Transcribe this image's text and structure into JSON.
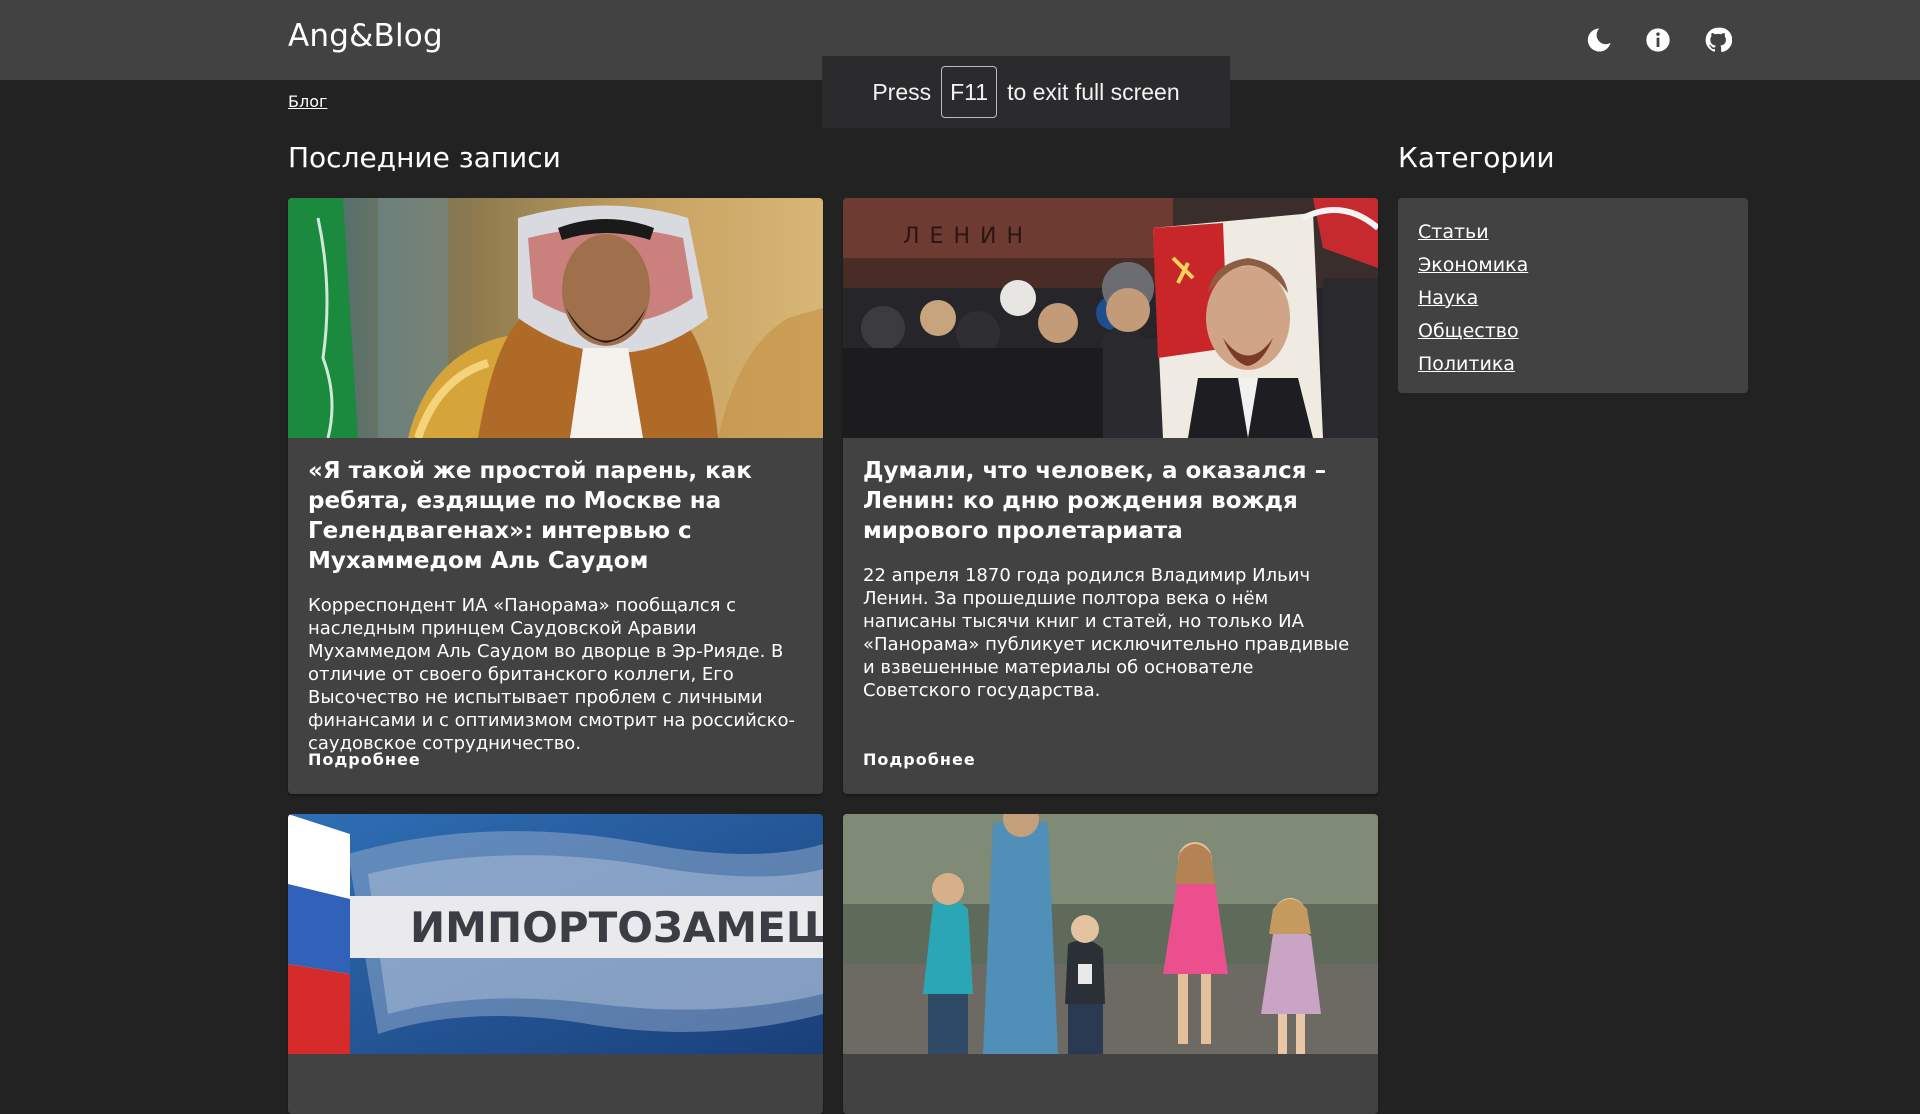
{
  "header": {
    "brand": "Ang&Blog",
    "icons": [
      "theme-toggle-icon",
      "info-icon",
      "github-icon"
    ]
  },
  "fullscreen_notice": {
    "prefix": "Press",
    "key": "F11",
    "suffix": "to exit full screen"
  },
  "breadcrumb": "Блог",
  "main": {
    "heading": "Последние записи",
    "more_label": "Подробнее",
    "posts": [
      {
        "title": "«Я такой же простой парень, как ребята, ездящие по Москве на Гелендвагенах»: интервью с Мухаммедом Аль Саудом",
        "excerpt": "Корреспондент ИА «Панорама» пообщался с наследным принцем Саудовской Аравии Мухаммедом Аль Саудом во дворце в Эр-Рияде. В отличие от своего британского коллеги, Его Высочество не испытывает проблем с личными финансами и с оптимизмом смотрит на российско-саудовское сотрудничество."
      },
      {
        "title": "Думали, что человек, а оказался – Ленин: ко дню рождения вождя мирового пролетариата",
        "excerpt": "22 апреля 1870 года родился Владимир Ильич Ленин. За прошедшие полтора века о нём написаны тысячи книг и статей, но только ИА «Панорама» публикует исключительно правдивые и взвешенные материалы об основателе Советского государства."
      },
      {
        "image_caption": "ИМПОРТОЗАМЕЩЕНИ"
      },
      {}
    ]
  },
  "sidebar": {
    "heading": "Категории",
    "categories": [
      "Статьи",
      "Экономика",
      "Наука",
      "Общество",
      "Политика"
    ]
  },
  "colors": {
    "background": "#222222",
    "topbar": "#424242",
    "card": "#424242",
    "text": "#ffffff"
  }
}
